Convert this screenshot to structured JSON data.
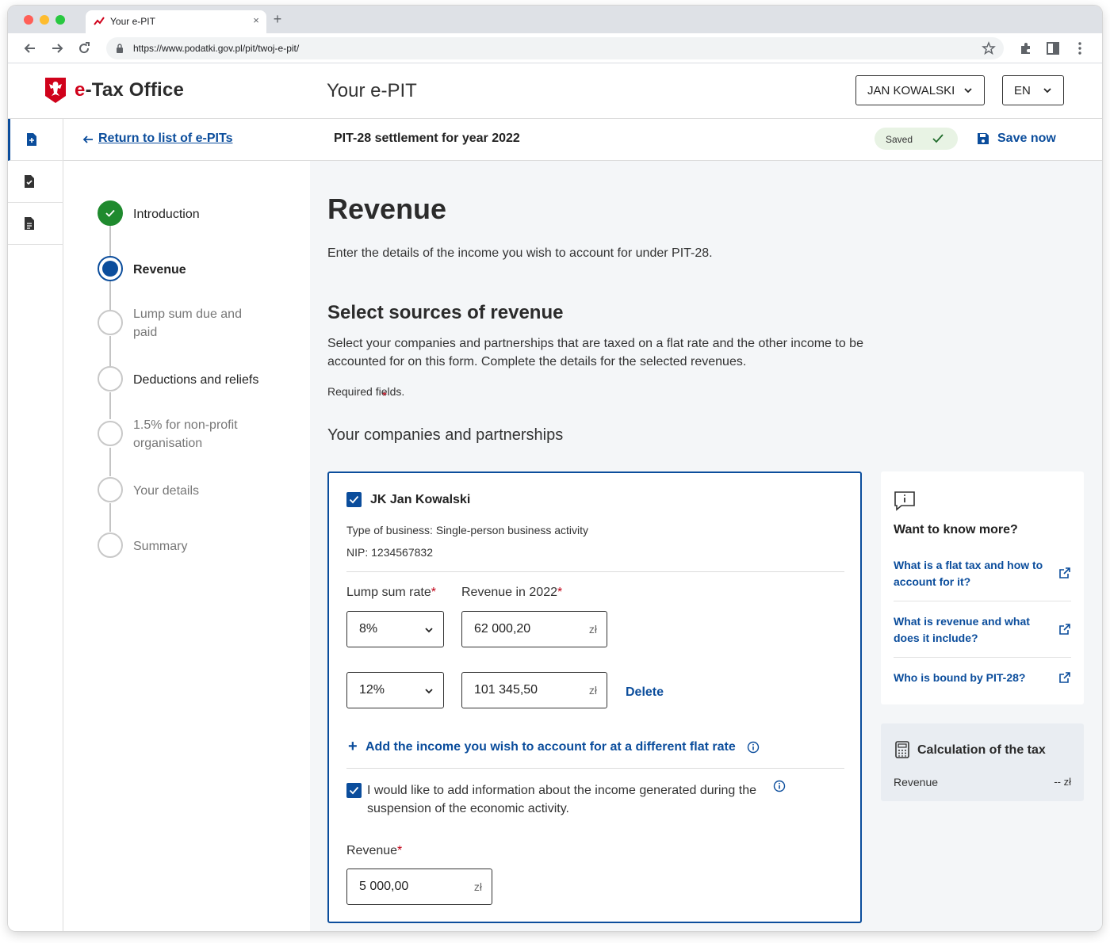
{
  "browser": {
    "tab_title": "Your e-PIT",
    "url": "https://www.podatki.gov.pl/pit/twoj-e-pit/"
  },
  "header": {
    "brand_prefix": "e",
    "brand_rest": "-Tax Office",
    "title": "Your e-PIT",
    "user": "JAN KOWALSKI",
    "language": "EN"
  },
  "subheader": {
    "return_link": "Return to list of e-PITs",
    "title": "PIT-28 settlement for year 2022",
    "saved": "Saved",
    "save_now": "Save now"
  },
  "steps": [
    {
      "label": "Introduction",
      "state": "done"
    },
    {
      "label": "Revenue",
      "state": "current"
    },
    {
      "label": "Lump sum due and paid",
      "state": "todo"
    },
    {
      "label": "Deductions and reliefs",
      "state": "todo"
    },
    {
      "label": "1.5% for non-profit organisation",
      "state": "todo"
    },
    {
      "label": "Your details",
      "state": "todo"
    },
    {
      "label": "Summary",
      "state": "todo"
    }
  ],
  "main": {
    "title": "Revenue",
    "intro": "Enter the details of the income you wish to account for under PIT-28.",
    "section_title": "Select sources of revenue",
    "section_desc": "Select your companies and partnerships that are taxed on a flat rate and the other income to be accounted for on this form. Complete the details for the selected revenues.",
    "required_star": "*",
    "required_note": "Required fields.",
    "companies_heading": "Your companies and partnerships"
  },
  "company": {
    "name": "JK Jan Kowalski",
    "type": "Type of business: Single-person business activity",
    "nip": "NIP: 1234567832",
    "lump_sum_label": "Lump sum rate",
    "revenue_label": "Revenue in 2022",
    "required_mark": "*",
    "rows": [
      {
        "rate": "8%",
        "amount": "62 000,20",
        "unit": "zł"
      },
      {
        "rate": "12%",
        "amount": "101 345,50",
        "unit": "zł"
      }
    ],
    "delete": "Delete",
    "add_plus": "+",
    "add_rate": "Add the income you wish to account for at a different flat rate",
    "suspension_checkbox": "I would like to add information about the income generated during the suspension of the economic activity.",
    "suspension_revenue_label": "Revenue",
    "suspension_revenue": "5 000,00",
    "suspension_unit": "zł"
  },
  "know_more": {
    "title": "Want to know more?",
    "links": [
      "What is a flat tax and how to account for it?",
      "What is revenue and what does it include?",
      "Who is bound by PIT-28?"
    ]
  },
  "calculation": {
    "title": "Calculation of the tax",
    "revenue_label": "Revenue",
    "revenue_value": "-- zł"
  },
  "colors": {
    "primary": "#0b4d9c",
    "success": "#1f8a2e",
    "required": "#c00016",
    "brand_red": "#d0021b"
  }
}
